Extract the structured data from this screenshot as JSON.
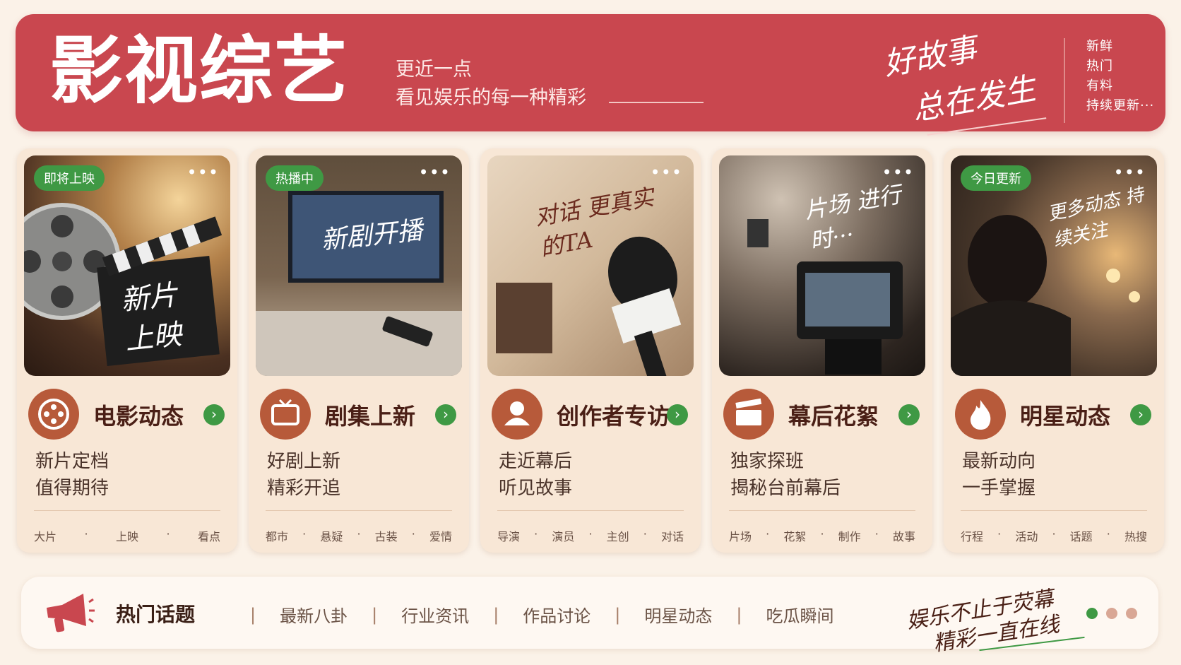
{
  "header": {
    "title": "影视综艺",
    "subtitle_line1": "更近一点",
    "subtitle_line2": "看见娱乐的每一种精彩",
    "script_line1": "好故事",
    "script_line2": "总在发生",
    "tags": [
      "新鲜",
      "热门",
      "有料",
      "持续更新···"
    ]
  },
  "cards": [
    {
      "badge": "即将上映",
      "photo_text": "新片 上映",
      "title": "电影动态",
      "desc1": "新片定档",
      "desc2": "值得期待",
      "keywords": [
        "大片",
        "上映",
        "看点"
      ],
      "icon": "film-reel-icon"
    },
    {
      "badge": "热播中",
      "photo_text": "新剧开播",
      "title": "剧集上新",
      "desc1": "好剧上新",
      "desc2": "精彩开追",
      "keywords": [
        "都市",
        "悬疑",
        "古装",
        "爱情"
      ],
      "icon": "tv-icon"
    },
    {
      "badge": "",
      "photo_text": "对话 更真实的TA",
      "title": "创作者专访",
      "desc1": "走近幕后",
      "desc2": "听见故事",
      "keywords": [
        "导演",
        "演员",
        "主创",
        "对话"
      ],
      "icon": "person-icon"
    },
    {
      "badge": "",
      "photo_text": "片场 进行时···",
      "title": "幕后花絮",
      "desc1": "独家探班",
      "desc2": "揭秘台前幕后",
      "keywords": [
        "片场",
        "花絮",
        "制作",
        "故事"
      ],
      "icon": "clapperboard-icon"
    },
    {
      "badge": "今日更新",
      "photo_text": "更多动态 持续关注",
      "title": "明星动态",
      "desc1": "最新动向",
      "desc2": "一手掌握",
      "keywords": [
        "行程",
        "活动",
        "话题",
        "热搜"
      ],
      "icon": "flame-icon"
    }
  ],
  "bottom": {
    "title": "热门话题",
    "nav": [
      "最新八卦",
      "行业资讯",
      "作品讨论",
      "明星动态",
      "吃瓜瞬间"
    ],
    "script_line1": "娱乐不止于荧幕",
    "script_line2": "精彩一直在线"
  },
  "colors": {
    "brand_red": "#c9474f",
    "accent_green": "#3f9944",
    "icon_brown": "#b75a3a",
    "card_bg": "#f8e7d6"
  }
}
